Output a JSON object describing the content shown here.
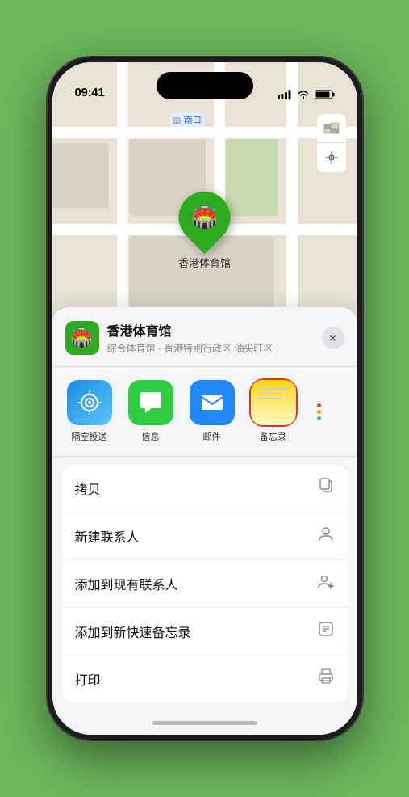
{
  "status_bar": {
    "time": "09:41",
    "signal": "●●●●",
    "wifi": "WiFi",
    "battery": "Battery"
  },
  "map": {
    "label_text": "南口",
    "pin_label": "香港体育馆"
  },
  "location_card": {
    "name": "香港体育馆",
    "subtitle": "综合体育馆 · 香港特别行政区 油尖旺区",
    "close_label": "×"
  },
  "share_apps": [
    {
      "id": "airdrop",
      "label": "隔空投送",
      "type": "airdrop"
    },
    {
      "id": "messages",
      "label": "信息",
      "type": "messages"
    },
    {
      "id": "mail",
      "label": "邮件",
      "type": "mail"
    },
    {
      "id": "notes",
      "label": "备忘录",
      "type": "notes"
    }
  ],
  "actions": [
    {
      "id": "copy",
      "label": "拷贝",
      "icon": "copy"
    },
    {
      "id": "new-contact",
      "label": "新建联系人",
      "icon": "person"
    },
    {
      "id": "add-existing",
      "label": "添加到现有联系人",
      "icon": "person-add"
    },
    {
      "id": "quick-note",
      "label": "添加到新快速备忘录",
      "icon": "note"
    },
    {
      "id": "print",
      "label": "打印",
      "icon": "print"
    }
  ]
}
